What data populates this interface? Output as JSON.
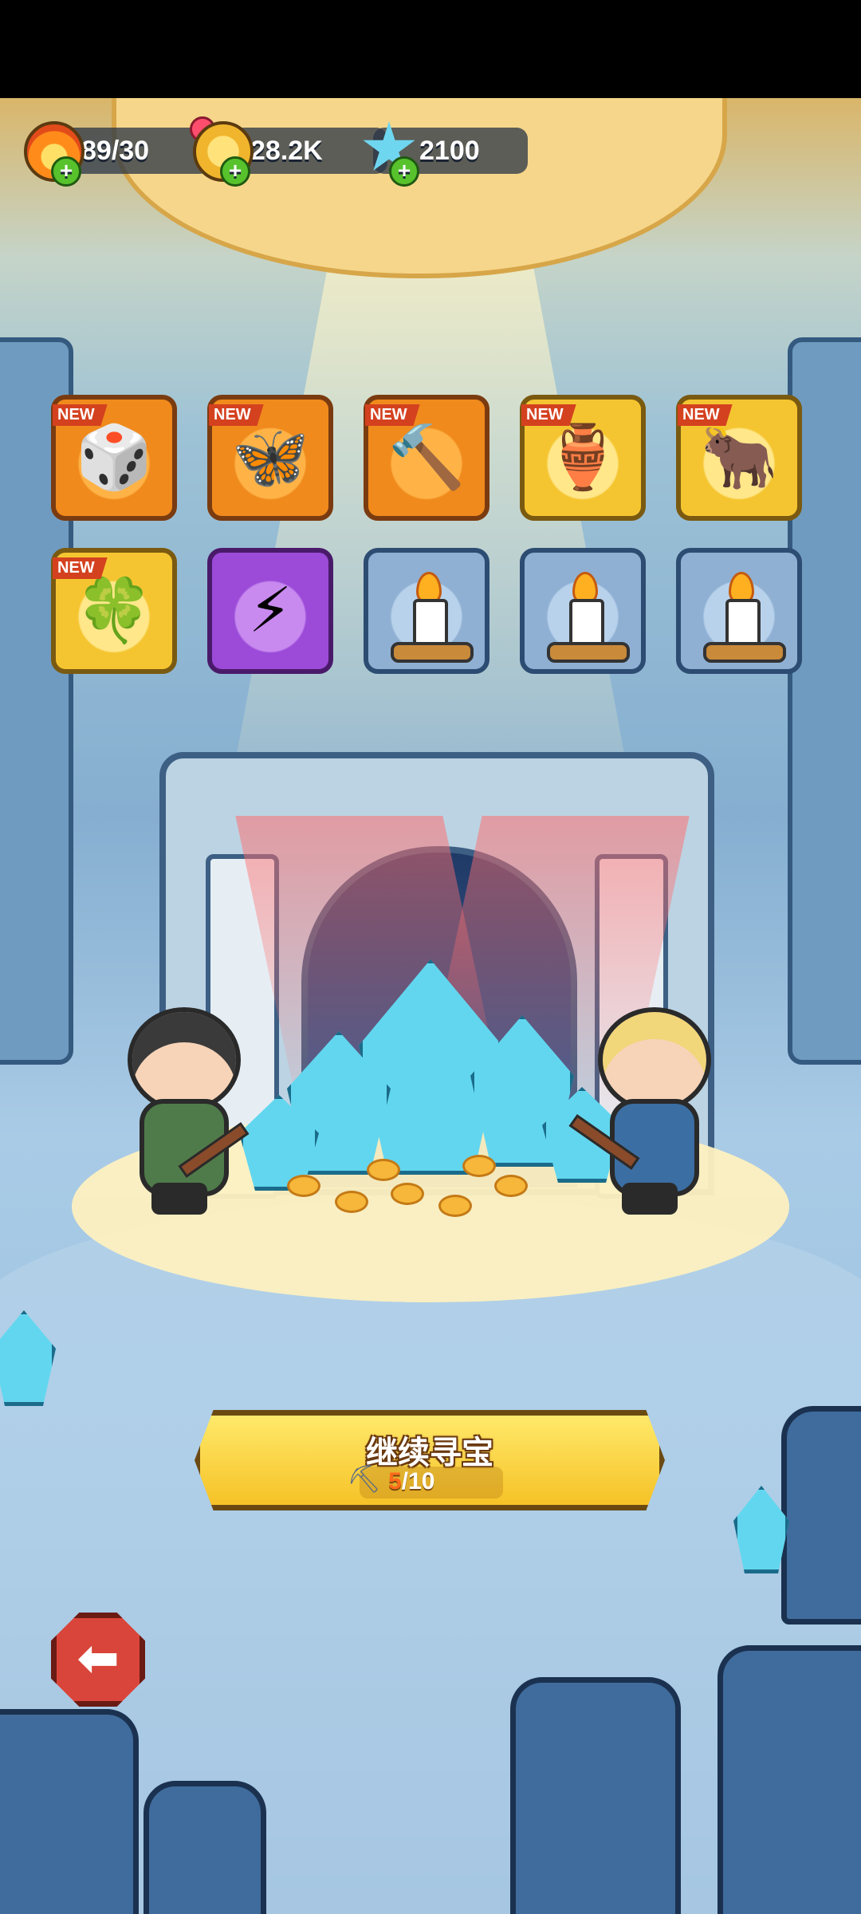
{
  "hud": {
    "energy": {
      "value": "89/30",
      "icon": "flame-icon"
    },
    "gold": {
      "value": "28.2K",
      "icon": "gold-coin-icon"
    },
    "gems": {
      "value": "2100",
      "icon": "blue-star-crystal-icon"
    }
  },
  "rewards": {
    "new_label": "NEW",
    "items": [
      {
        "name": "d20-dice",
        "glyph": "🎲",
        "new": true,
        "rarity": "orange"
      },
      {
        "name": "butterfly-orb",
        "glyph": "🦋",
        "new": true,
        "rarity": "orange"
      },
      {
        "name": "stone-hammer",
        "glyph": "🔨",
        "new": true,
        "rarity": "orange"
      },
      {
        "name": "bronze-vase",
        "glyph": "🏺",
        "new": true,
        "rarity": "yellow"
      },
      {
        "name": "ox-totem",
        "glyph": "🐂",
        "new": true,
        "rarity": "yellow"
      },
      {
        "name": "clover-crown",
        "glyph": "🍀",
        "new": true,
        "rarity": "yellow"
      },
      {
        "name": "lightning-card",
        "glyph": "⚡",
        "new": false,
        "rarity": "purple"
      },
      {
        "name": "candle",
        "new": false,
        "rarity": "blue"
      },
      {
        "name": "candle",
        "new": false,
        "rarity": "blue"
      },
      {
        "name": "candle",
        "new": false,
        "rarity": "blue"
      }
    ]
  },
  "continue_button": {
    "label": "继续寻宝",
    "progress_current": "5",
    "progress_total": "/10",
    "progress_fraction": 0.5
  },
  "colors": {
    "button_yellow": "#f6c227",
    "back_red": "#d9453a",
    "new_tag": "#d4411f"
  }
}
